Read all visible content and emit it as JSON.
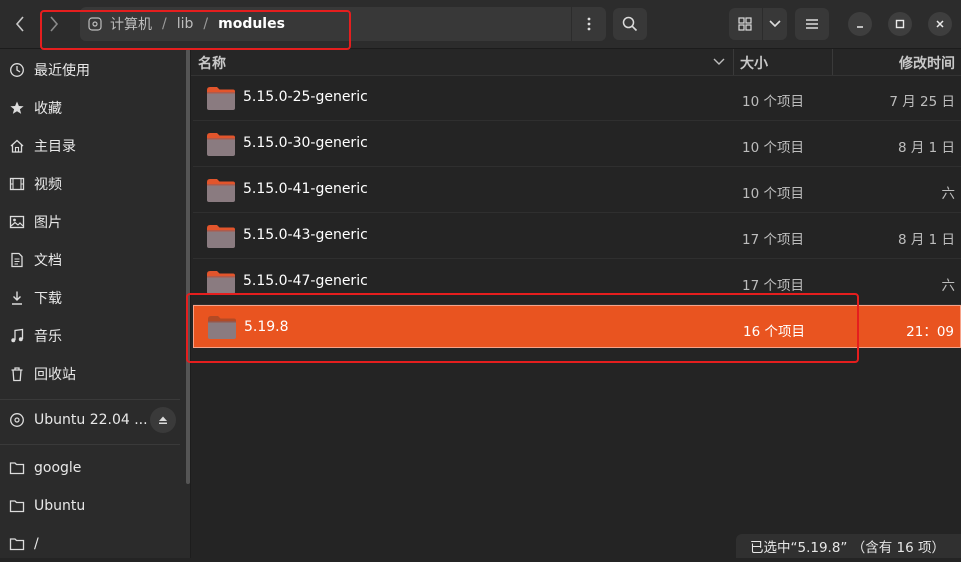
{
  "path": {
    "crumbs": [
      "计算机",
      "lib",
      "modules"
    ]
  },
  "toolbar": {
    "back_icon": "chevron-left-icon",
    "forward_icon": "chevron-right-icon",
    "search_icon": "search-icon"
  },
  "sidebar": {
    "places": [
      {
        "label": "最近使用",
        "icon": "clock-icon"
      },
      {
        "label": "收藏",
        "icon": "star-icon"
      },
      {
        "label": "主目录",
        "icon": "home-icon"
      },
      {
        "label": "视频",
        "icon": "video-icon"
      },
      {
        "label": "图片",
        "icon": "image-icon"
      },
      {
        "label": "文档",
        "icon": "document-icon"
      },
      {
        "label": "下载",
        "icon": "download-icon"
      },
      {
        "label": "音乐",
        "icon": "music-icon"
      },
      {
        "label": "回收站",
        "icon": "trash-icon"
      }
    ],
    "device": {
      "label": "Ubuntu 22.04 ...",
      "icon": "disc-icon"
    },
    "bookmarks": [
      {
        "label": "google",
        "icon": "folder-icon"
      },
      {
        "label": "Ubuntu",
        "icon": "folder-icon"
      },
      {
        "label": "/",
        "icon": "folder-icon"
      }
    ]
  },
  "columns": {
    "name": "名称",
    "size": "大小",
    "modified": "修改时间"
  },
  "files": [
    {
      "name": "5.15.0-25-generic",
      "size": "10 个项目",
      "modified": "7 月 25 日"
    },
    {
      "name": "5.15.0-30-generic",
      "size": "10 个项目",
      "modified": "8 月 1 日"
    },
    {
      "name": "5.15.0-41-generic",
      "size": "10 个项目",
      "modified": "六"
    },
    {
      "name": "5.15.0-43-generic",
      "size": "17 个项目",
      "modified": "8 月 1 日"
    },
    {
      "name": "5.15.0-47-generic",
      "size": "17 个项目",
      "modified": "六"
    },
    {
      "name": "5.19.8",
      "size": "16 个项目",
      "modified": "21：09",
      "selected": true
    }
  ],
  "status": "已选中“5.19.8” （含有 16 项）",
  "colors": {
    "accent": "#e95420",
    "annotation": "#e51e1e",
    "folder": "#8a7b80"
  }
}
